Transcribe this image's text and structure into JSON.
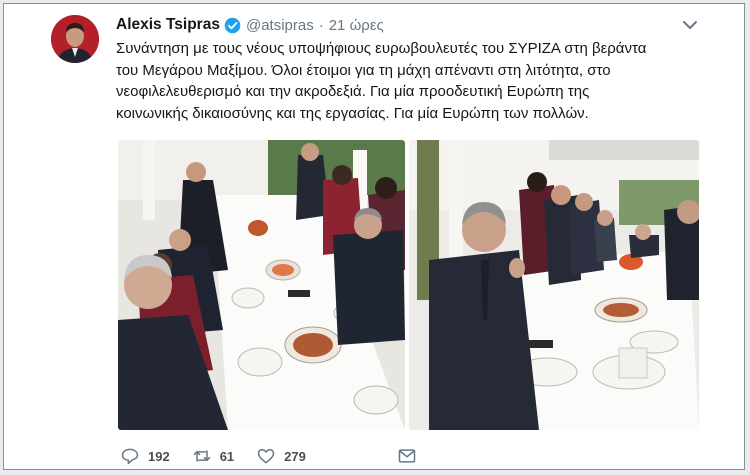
{
  "tweet": {
    "author_name": "Alexis Tsipras",
    "handle": "@atsipras",
    "separator": "·",
    "time": "21 ώρες",
    "text": "Συνάντηση με τους νέους υποψήφιους ευρωβουλευτές του ΣΥΡΙΖΑ στη βεράντα\nτου Μεγάρου Μαξίμου. Όλοι έτοιμοι για τη μάχη απέναντι στη λιτότητα, στο\nνεοφιλελευθερισμό και την ακροδεξιά. Για μία προοδευτική Ευρώπη της\nκοινωνικής δικαιοσύνης και της εργασίας. Για μία Ευρώπη των πολλών.",
    "avatar_icon": "profile-photo",
    "verified_icon": "verified-badge-icon"
  },
  "actions": {
    "replies": "192",
    "retweets": "61",
    "likes": "279"
  },
  "icons": {
    "reply": "reply-icon",
    "retweet": "retweet-icon",
    "like": "heart-icon",
    "dm": "envelope-icon",
    "more": "chevron-down-icon"
  },
  "colors": {
    "verified": "#1da1f2",
    "muted_text": "#657786",
    "avatar_bg": "#b3202a"
  }
}
